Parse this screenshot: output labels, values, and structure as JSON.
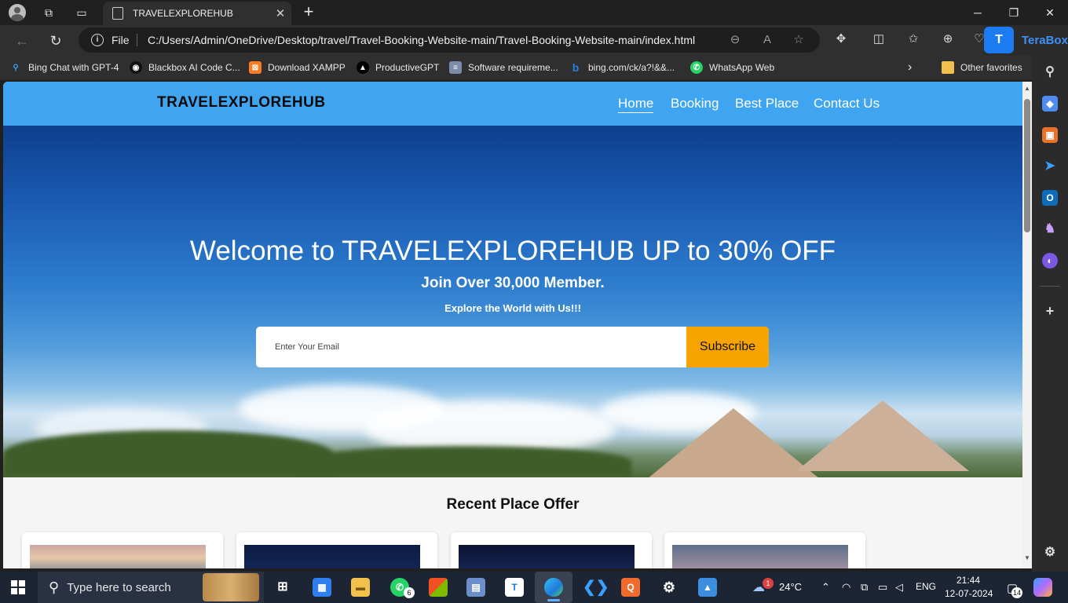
{
  "browser": {
    "tab_title": "TRAVELEXPLOREHUB",
    "url_scheme": "File",
    "url": "C:/Users/Admin/OneDrive/Desktop/travel/Travel-Booking-Website-main/Travel-Booking-Website-main/index.html",
    "extension_label": "TeraBox",
    "favorites": [
      {
        "label": "Bing Chat with GPT-4",
        "icon": "search-icon",
        "color": "#3aa0ff"
      },
      {
        "label": "Blackbox AI Code C...",
        "icon": "blackbox-icon",
        "color": "#111111"
      },
      {
        "label": "Download XAMPP",
        "icon": "xampp-icon",
        "color": "#fb7a24"
      },
      {
        "label": "ProductiveGPT",
        "icon": "triangle-icon",
        "color": "#000000"
      },
      {
        "label": "Software requireme...",
        "icon": "document-icon",
        "color": "#7a8ca8"
      },
      {
        "label": "bing.com/ck/a?!&&...",
        "icon": "bing-icon",
        "color": "#2a7de1"
      },
      {
        "label": "WhatsApp Web",
        "icon": "whatsapp-icon",
        "color": "#25d366"
      }
    ],
    "other_favorites": "Other favorites"
  },
  "site": {
    "logo": "TRAVELEXPLOREHUB",
    "nav": [
      "Home",
      "Booking",
      "Best Place",
      "Contact Us"
    ],
    "hero": {
      "title": "Welcome to TRAVELEXPLOREHUB UP to 30% OFF",
      "subtitle": "Join Over 30,000 Member.",
      "tagline": "Explore the World with Us!!!",
      "email_placeholder": "Enter Your Email",
      "subscribe_label": "Subscribe"
    },
    "section_title": "Recent Place Offer"
  },
  "taskbar": {
    "search_placeholder": "Type here to search",
    "whatsapp_badge": "6",
    "weather_badge": "1",
    "temperature": "24°C",
    "language": "ENG",
    "time": "21:44",
    "date": "12-07-2024",
    "notification_count": "14"
  }
}
